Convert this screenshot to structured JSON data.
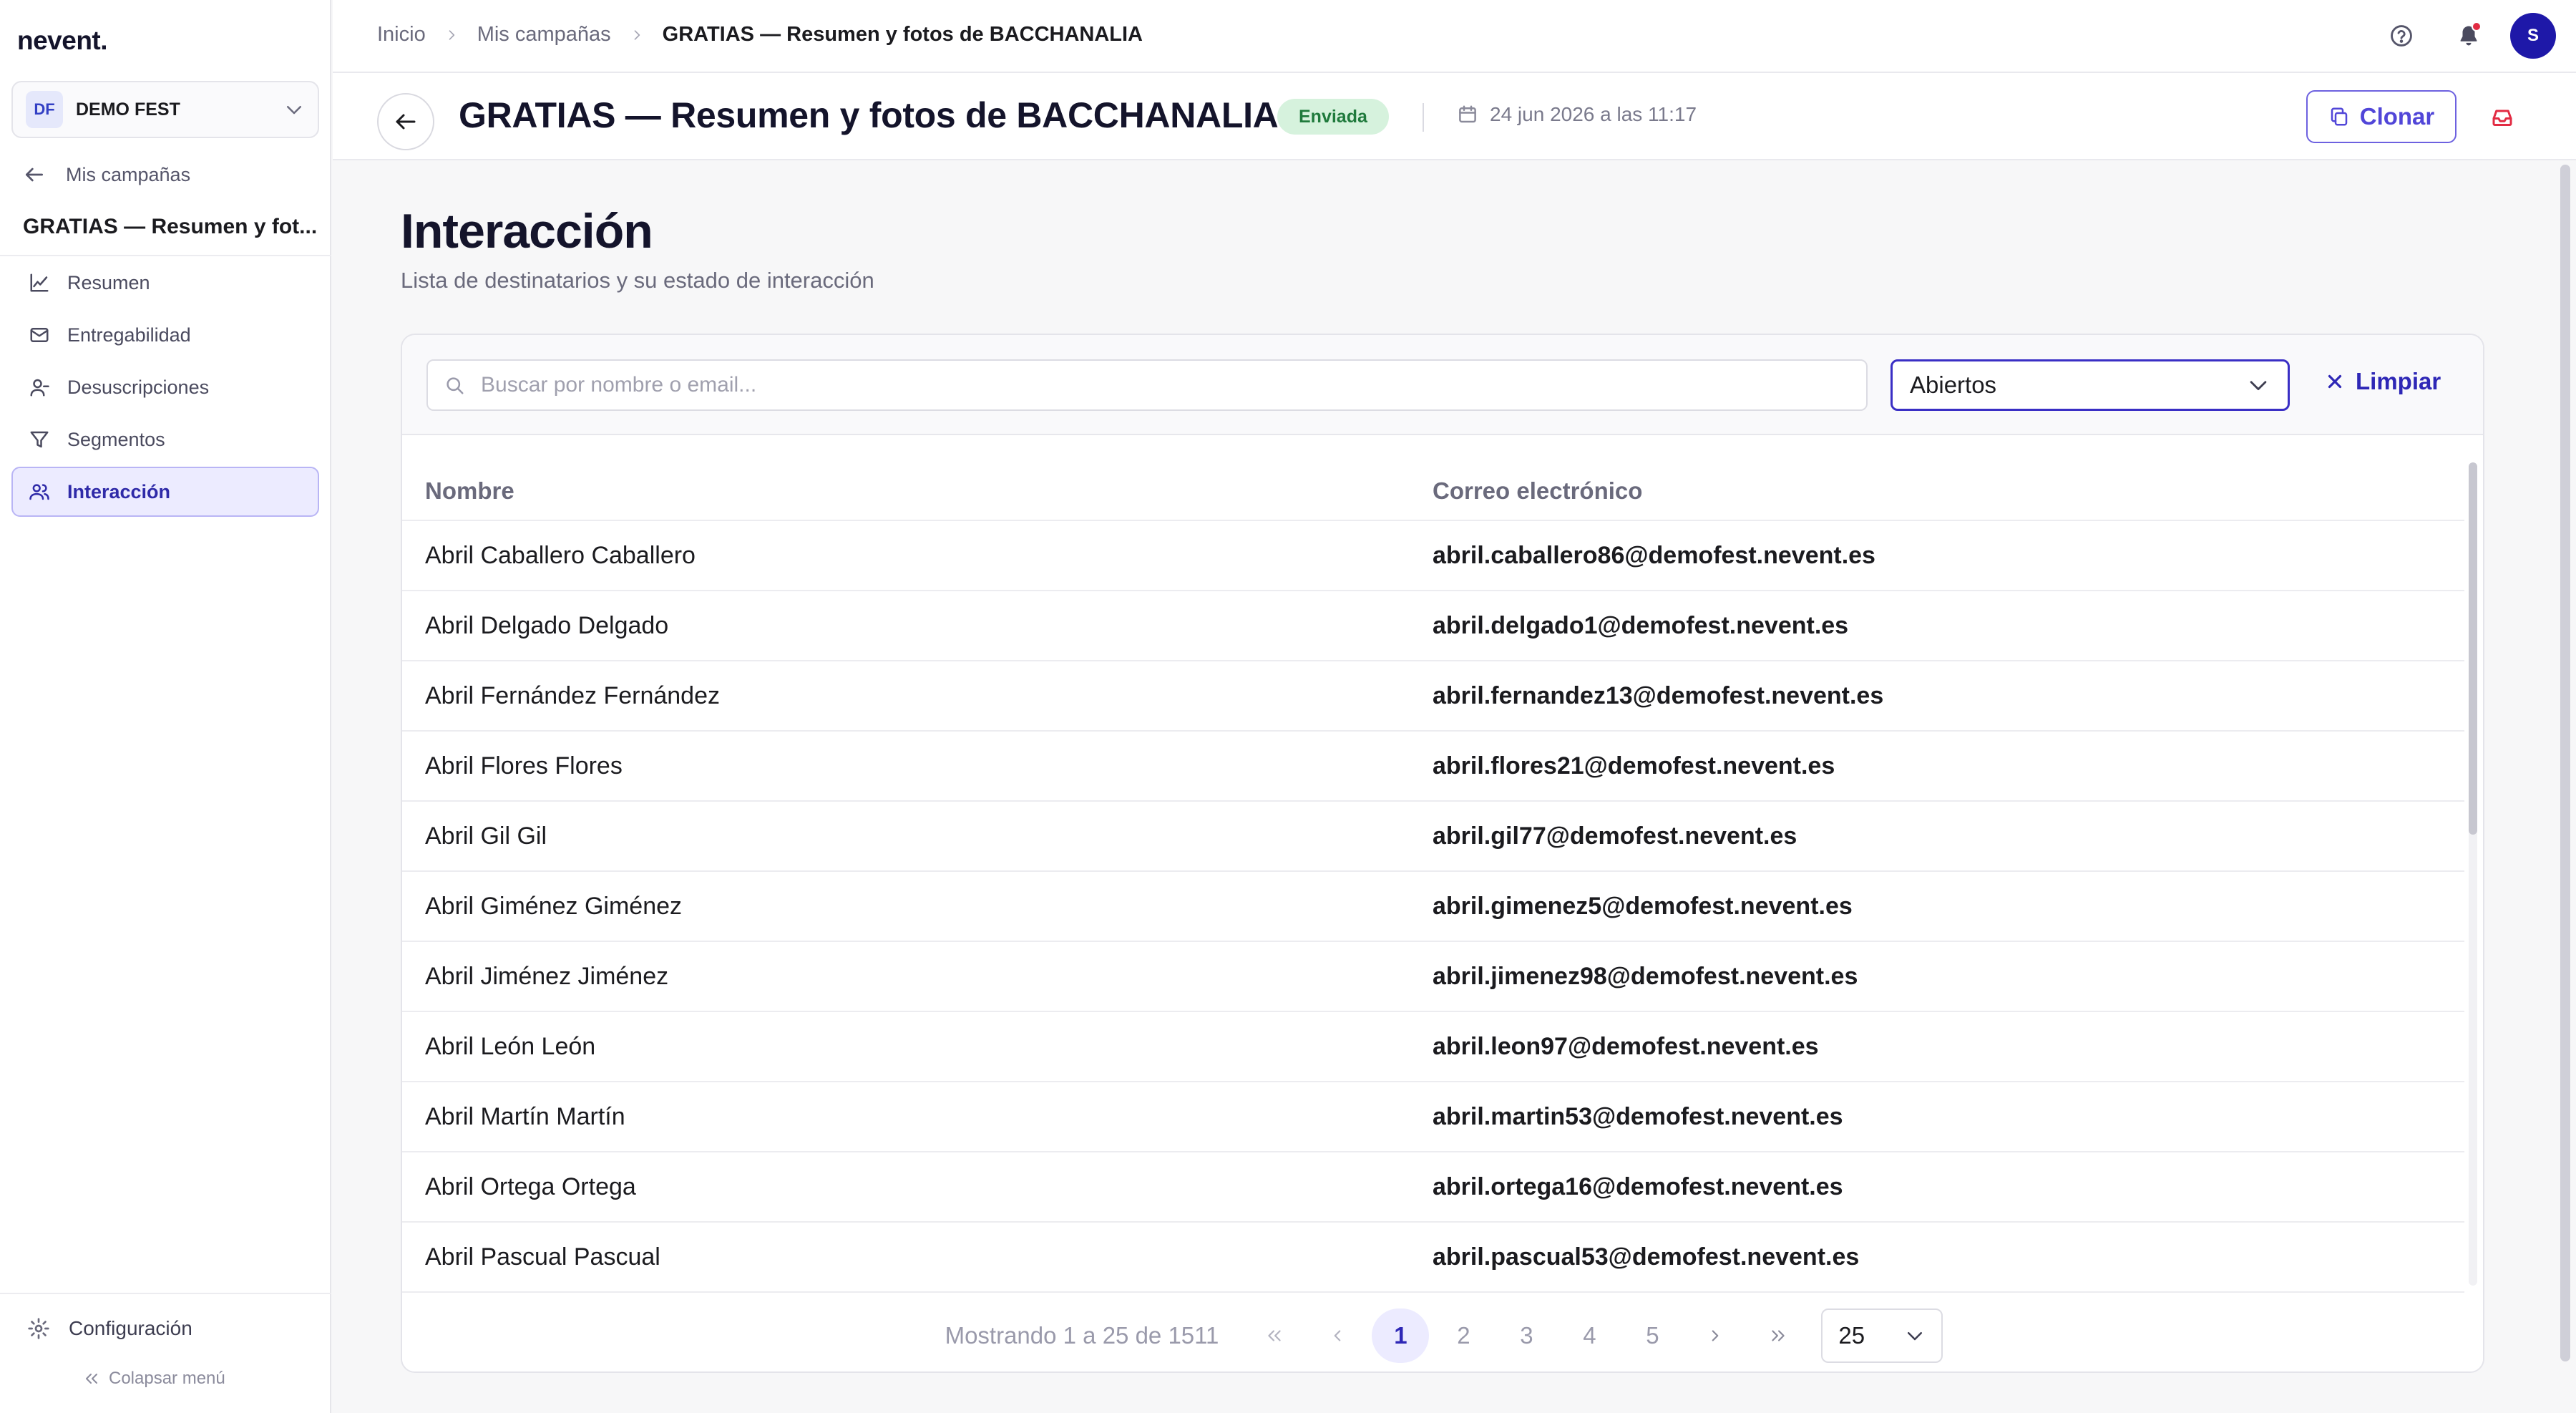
{
  "app": {
    "logo": "nevent."
  },
  "sidebar": {
    "org_initials": "DF",
    "org_name": "DEMO FEST",
    "back_label": "Mis campañas",
    "campaign_name": "GRATIAS — Resumen y fot...",
    "nav": [
      {
        "label": "Resumen",
        "icon": "chart-line-icon"
      },
      {
        "label": "Entregabilidad",
        "icon": "mail-icon"
      },
      {
        "label": "Desuscripciones",
        "icon": "user-minus-icon"
      },
      {
        "label": "Segmentos",
        "icon": "filter-icon"
      },
      {
        "label": "Interacción",
        "icon": "users-icon",
        "active": true
      }
    ],
    "settings_label": "Configuración",
    "collapse_label": "Colapsar menú"
  },
  "topbar": {
    "breadcrumbs": [
      "Inicio",
      "Mis campañas",
      "GRATIAS — Resumen y fotos de BACCHANALIA"
    ],
    "avatar_initial": "S"
  },
  "header": {
    "title": "GRATIAS — Resumen y fotos de BACCHANALIA",
    "status": "Enviada",
    "date": "24 jun 2026 a las 11:17",
    "clone_label": "Clonar"
  },
  "main": {
    "title": "Interacción",
    "subtitle": "Lista de destinatarios y su estado de interacción"
  },
  "filters": {
    "search_placeholder": "Buscar por nombre o email...",
    "search_value": "",
    "status_value": "Abiertos",
    "clear_label": "Limpiar"
  },
  "table": {
    "columns": [
      "Nombre",
      "Correo electrónico"
    ],
    "rows": [
      {
        "name": "Abril Caballero Caballero",
        "email": "abril.caballero86@demofest.nevent.es"
      },
      {
        "name": "Abril Delgado Delgado",
        "email": "abril.delgado1@demofest.nevent.es"
      },
      {
        "name": "Abril Fernández Fernández",
        "email": "abril.fernandez13@demofest.nevent.es"
      },
      {
        "name": "Abril Flores Flores",
        "email": "abril.flores21@demofest.nevent.es"
      },
      {
        "name": "Abril Gil Gil",
        "email": "abril.gil77@demofest.nevent.es"
      },
      {
        "name": "Abril Giménez Giménez",
        "email": "abril.gimenez5@demofest.nevent.es"
      },
      {
        "name": "Abril Jiménez Jiménez",
        "email": "abril.jimenez98@demofest.nevent.es"
      },
      {
        "name": "Abril León León",
        "email": "abril.leon97@demofest.nevent.es"
      },
      {
        "name": "Abril Martín Martín",
        "email": "abril.martin53@demofest.nevent.es"
      },
      {
        "name": "Abril Ortega Ortega",
        "email": "abril.ortega16@demofest.nevent.es"
      },
      {
        "name": "Abril Pascual Pascual",
        "email": "abril.pascual53@demofest.nevent.es"
      }
    ]
  },
  "pagination": {
    "info": "Mostrando 1 a 25 de 1511",
    "pages": [
      "1",
      "2",
      "3",
      "4",
      "5"
    ],
    "current_page": "1",
    "page_size": "25"
  },
  "colors": {
    "accent": "#2e27b6",
    "status_sent_bg": "#d6f2dd",
    "status_sent_text": "#1f7a3c",
    "notification": "#e22b43"
  }
}
